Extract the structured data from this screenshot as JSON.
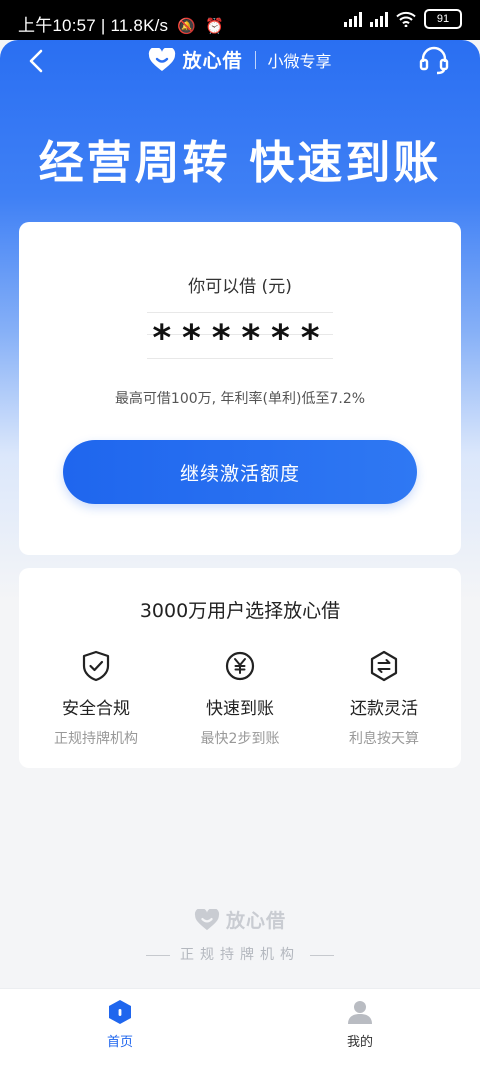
{
  "status_bar": {
    "time": "上午10:57",
    "network_speed": "11.8K/s",
    "battery": "91"
  },
  "header": {
    "brand_name": "放心借",
    "brand_sub": "小微专享"
  },
  "hero": {
    "slogan": "经营周转 快速到账"
  },
  "loan_card": {
    "label": "你可以借 (元)",
    "masked_amount": "******",
    "rate_note": "最高可借100万, 年利率(单利)低至7.2%",
    "activate_button": "继续激活额度"
  },
  "features": {
    "title": "3000万用户选择放心借",
    "items": [
      {
        "name": "安全合规",
        "desc": "正规持牌机构",
        "icon": "shield-check-icon"
      },
      {
        "name": "快速到账",
        "desc": "最快2步到账",
        "icon": "yuan-circle-icon"
      },
      {
        "name": "还款灵活",
        "desc": "利息按天算",
        "icon": "exchange-icon"
      }
    ]
  },
  "footer": {
    "brand_name": "放心借",
    "tagline": "正规持牌机构"
  },
  "tabbar": {
    "items": [
      {
        "label": "首页",
        "icon": "home-icon",
        "active": true
      },
      {
        "label": "我的",
        "icon": "user-icon",
        "active": false
      }
    ]
  },
  "colors": {
    "primary": "#1f66ee",
    "hero_top": "#2a6ff2",
    "background": "#f4f5f7",
    "tab_active": "#1f66ee",
    "tab_inactive": "#333333"
  }
}
